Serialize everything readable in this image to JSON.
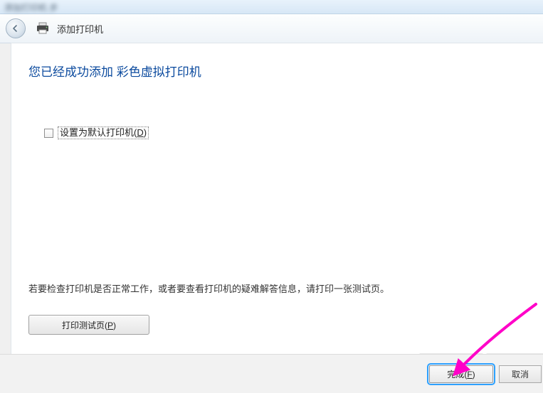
{
  "titlebar": {
    "blurred_text": "添加打印机  步"
  },
  "header": {
    "back_label": "back",
    "title": "添加打印机"
  },
  "main": {
    "heading": "您已经成功添加 彩色虚拟打印机",
    "checkbox": {
      "checked": false,
      "label_before": "设置为默认打印机(",
      "mnemonic": "D",
      "label_after": ")"
    },
    "instruction": "若要检查打印机是否正常工作，或者要查看打印机的疑难解答信息，请打印一张测试页。",
    "test_button": {
      "label_before": "打印测试页(",
      "mnemonic": "P",
      "label_after": ")"
    }
  },
  "footer": {
    "finish": {
      "label_before": "完成(",
      "mnemonic": "F",
      "label_after": ")"
    },
    "cancel_label": "取消"
  },
  "annotation": {
    "arrow_color": "#ff00c8"
  }
}
